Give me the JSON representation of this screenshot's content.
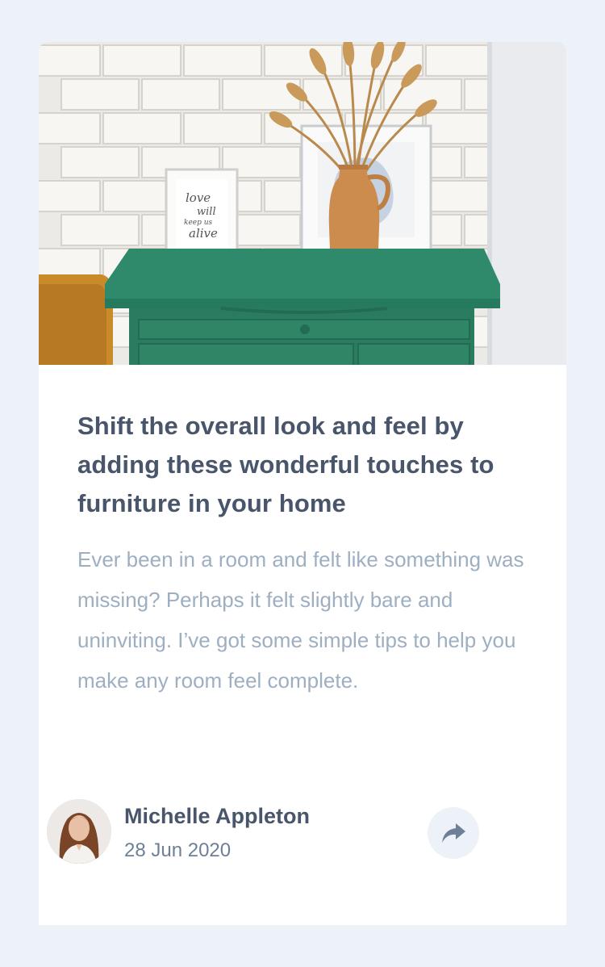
{
  "article": {
    "title": "Shift the overall look and feel by adding these wonderful touches to furniture in your home",
    "excerpt": "Ever been in a room and felt like something was missing? Perhaps it felt slightly bare and uninviting. I’ve got some simple tips to help you make any room feel complete."
  },
  "author": {
    "name": "Michelle Appleton",
    "date": "28 Jun 2020"
  },
  "share": {
    "icon": "share-arrow-icon"
  },
  "colors": {
    "background": "#ecf2f8",
    "card": "#ffffff",
    "title": "#48556a",
    "excerpt": "#9eafc2",
    "date": "#6e8098",
    "dresser": "#2e8a6a"
  }
}
